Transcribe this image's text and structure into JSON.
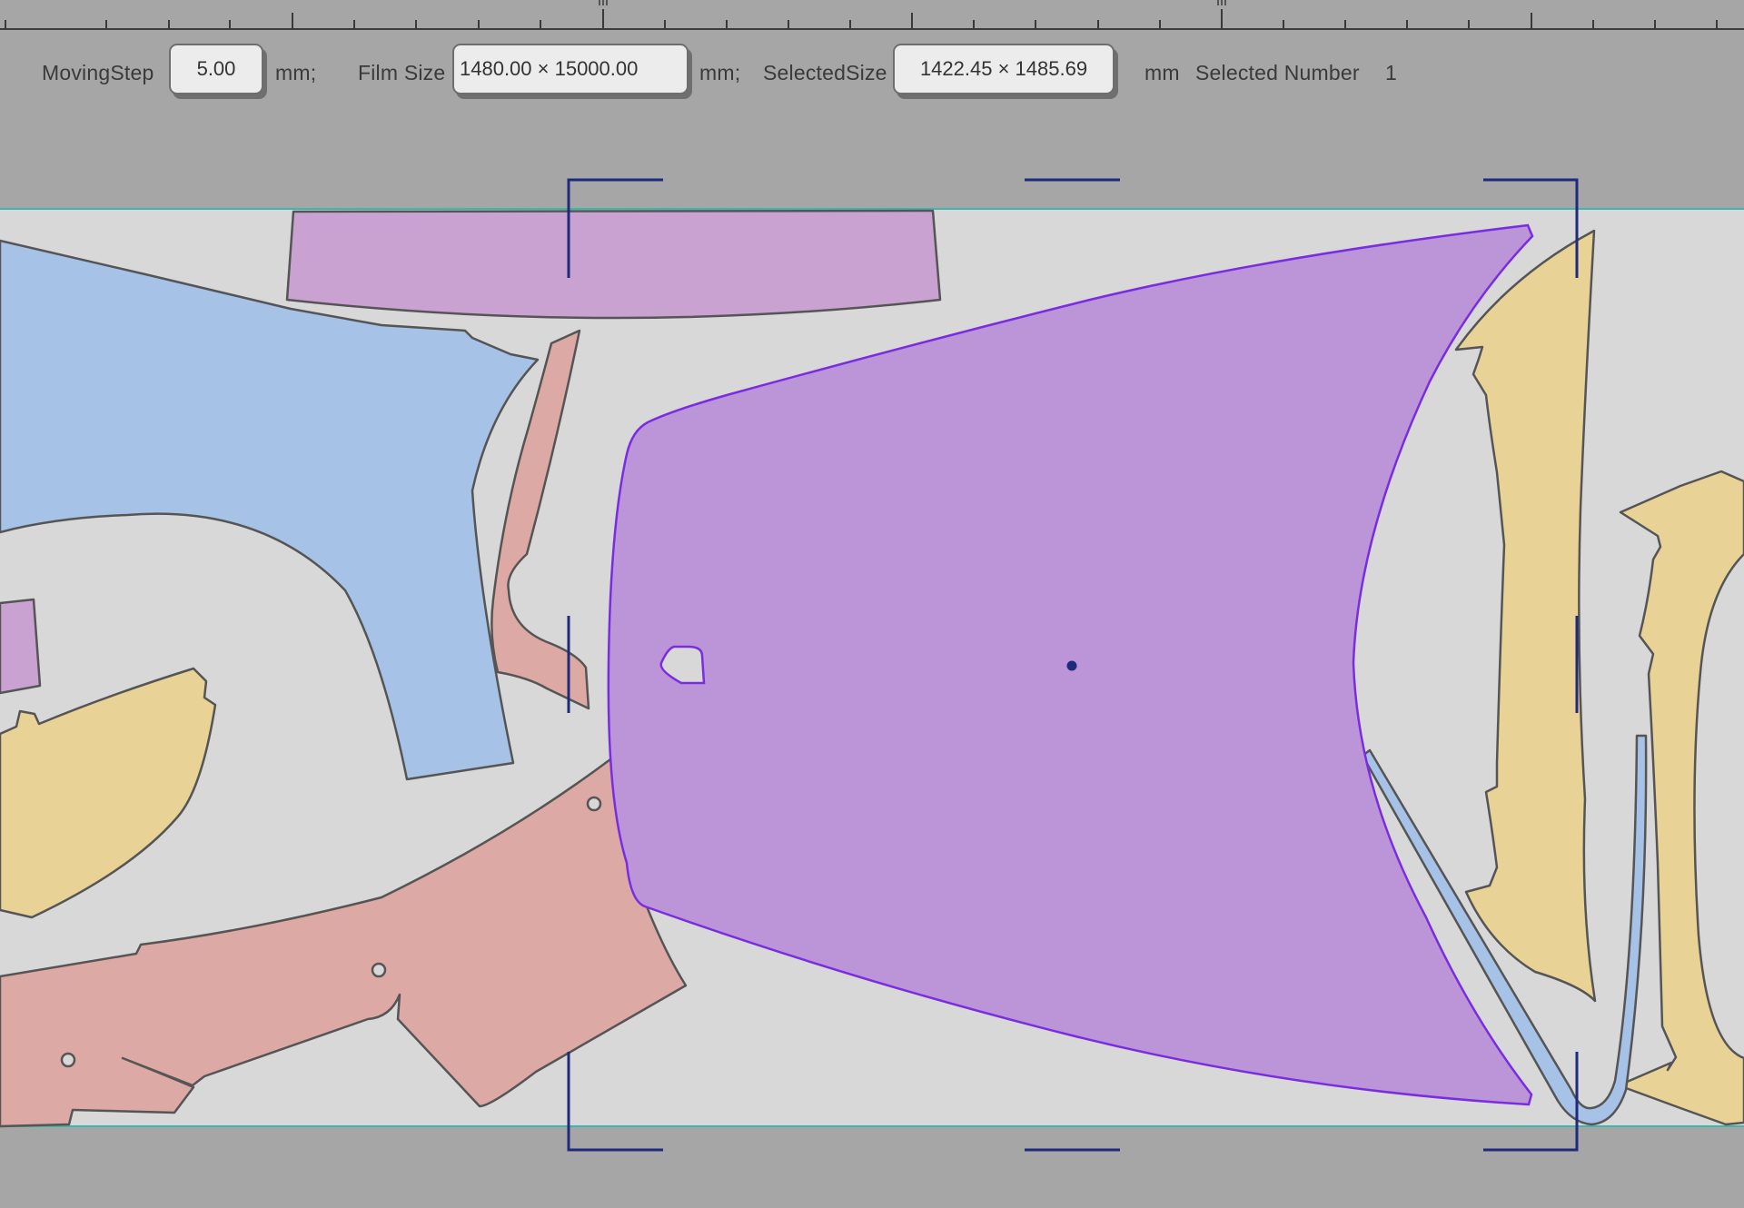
{
  "toolbar": {
    "moving_step_label": "MovingStep",
    "moving_step_value": "5.00",
    "moving_step_unit": "mm;",
    "film_size_label": "Film Size",
    "film_size_value": "1480.00 × 15000.00",
    "film_size_unit": "mm;",
    "selected_size_label": "SelectedSize",
    "selected_size_value": "1422.45 × 1485.69",
    "selected_size_unit": "mm",
    "selected_number_label": "Selected Number",
    "selected_number_value": "1"
  },
  "colors": {
    "background": "#a6a6a6",
    "film": "#d8d8d8",
    "film_border": "#3fb6ac",
    "selection_frame": "#1f2a7a",
    "selected_piece_fill": "#bb95d7",
    "selected_piece_stroke": "#7a2de0",
    "piece_blue": "#a7c2e7",
    "piece_pink": "#c9a2d1",
    "piece_salmon": "#dda9a4",
    "piece_yellow": "#e8d295",
    "piece_stroke": "#555555"
  },
  "icons": {
    "selection_center": "crosshair-dot-icon"
  }
}
